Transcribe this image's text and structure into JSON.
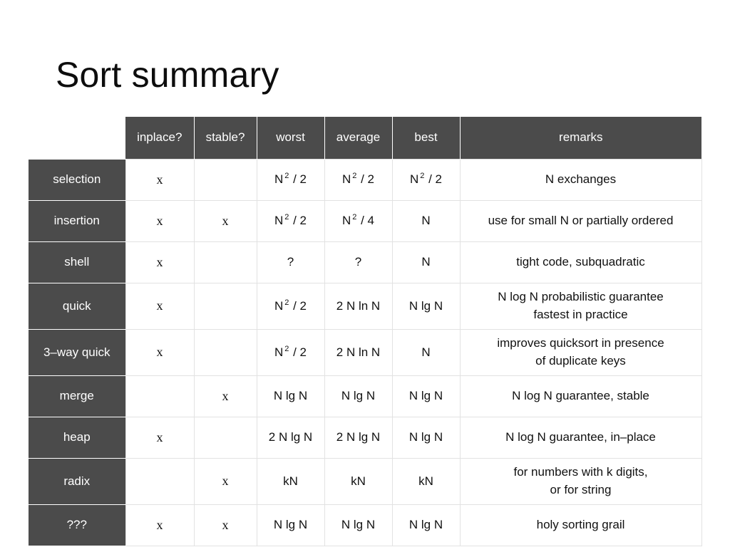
{
  "slide": {
    "title": "Sort summary",
    "background_color": "#ffffff",
    "header_color": "#4b4b4b",
    "header_text_color": "#ffffff",
    "grid_line_color": "#e2e2e2",
    "body_text_color": "#111111"
  },
  "table": {
    "corner_label": "",
    "columns": [
      {
        "key": "inplace",
        "label": "inplace?"
      },
      {
        "key": "stable",
        "label": "stable?"
      },
      {
        "key": "worst",
        "label": "worst"
      },
      {
        "key": "average",
        "label": "average"
      },
      {
        "key": "best",
        "label": "best"
      },
      {
        "key": "remarks",
        "label": "remarks"
      }
    ],
    "mark": "x",
    "rows": [
      {
        "name": "selection",
        "inplace": "x",
        "stable": "",
        "worst": {
          "base": "N",
          "sup": "2",
          "tail": " / 2"
        },
        "average": {
          "base": "N",
          "sup": "2",
          "tail": " / 2"
        },
        "best": {
          "base": "N",
          "sup": "2",
          "tail": " / 2"
        },
        "remarks": [
          "N exchanges"
        ]
      },
      {
        "name": "insertion",
        "inplace": "x",
        "stable": "x",
        "worst": {
          "base": "N",
          "sup": "2",
          "tail": " / 2"
        },
        "average": {
          "base": "N",
          "sup": "2",
          "tail": " / 4"
        },
        "best": {
          "base": "N",
          "sup": "",
          "tail": ""
        },
        "remarks": [
          "use for small N or partially ordered"
        ]
      },
      {
        "name": "shell",
        "inplace": "x",
        "stable": "",
        "worst": {
          "base": "?",
          "sup": "",
          "tail": ""
        },
        "average": {
          "base": "?",
          "sup": "",
          "tail": ""
        },
        "best": {
          "base": "N",
          "sup": "",
          "tail": ""
        },
        "remarks": [
          "tight code, subquadratic"
        ]
      },
      {
        "name": "quick",
        "inplace": "x",
        "stable": "",
        "worst": {
          "base": "N",
          "sup": "2",
          "tail": " / 2"
        },
        "average": {
          "base": "2 N ln N",
          "sup": "",
          "tail": ""
        },
        "best": {
          "base": "N lg N",
          "sup": "",
          "tail": ""
        },
        "remarks": [
          "N log N  probabilistic guarantee",
          "fastest in practice"
        ]
      },
      {
        "name": "3–way quick",
        "inplace": "x",
        "stable": "",
        "worst": {
          "base": "N",
          "sup": "2",
          "tail": " / 2"
        },
        "average": {
          "base": "2 N ln N",
          "sup": "",
          "tail": ""
        },
        "best": {
          "base": "N",
          "sup": "",
          "tail": ""
        },
        "remarks": [
          "improves quicksort in presence",
          "of duplicate keys"
        ]
      },
      {
        "name": "merge",
        "inplace": "",
        "stable": "x",
        "worst": {
          "base": "N lg N",
          "sup": "",
          "tail": ""
        },
        "average": {
          "base": "N lg N",
          "sup": "",
          "tail": ""
        },
        "best": {
          "base": "N lg N",
          "sup": "",
          "tail": ""
        },
        "remarks": [
          "N log N  guarantee, stable"
        ]
      },
      {
        "name": "heap",
        "inplace": "x",
        "stable": "",
        "worst": {
          "base": "2 N lg N",
          "sup": "",
          "tail": ""
        },
        "average": {
          "base": "2 N lg N",
          "sup": "",
          "tail": ""
        },
        "best": {
          "base": "N lg N",
          "sup": "",
          "tail": ""
        },
        "remarks": [
          "N log N  guarantee, in–place"
        ]
      },
      {
        "name": "radix",
        "inplace": "",
        "stable": "x",
        "worst": {
          "base": "kN",
          "sup": "",
          "tail": ""
        },
        "average": {
          "base": "kN",
          "sup": "",
          "tail": ""
        },
        "best": {
          "base": "kN",
          "sup": "",
          "tail": ""
        },
        "remarks": [
          "for numbers with k digits,",
          "or for string"
        ]
      },
      {
        "name": "???",
        "inplace": "x",
        "stable": "x",
        "worst": {
          "base": "N lg N",
          "sup": "",
          "tail": ""
        },
        "average": {
          "base": "N lg N",
          "sup": "",
          "tail": ""
        },
        "best": {
          "base": "N lg N",
          "sup": "",
          "tail": ""
        },
        "remarks": [
          "holy sorting grail"
        ]
      }
    ]
  }
}
